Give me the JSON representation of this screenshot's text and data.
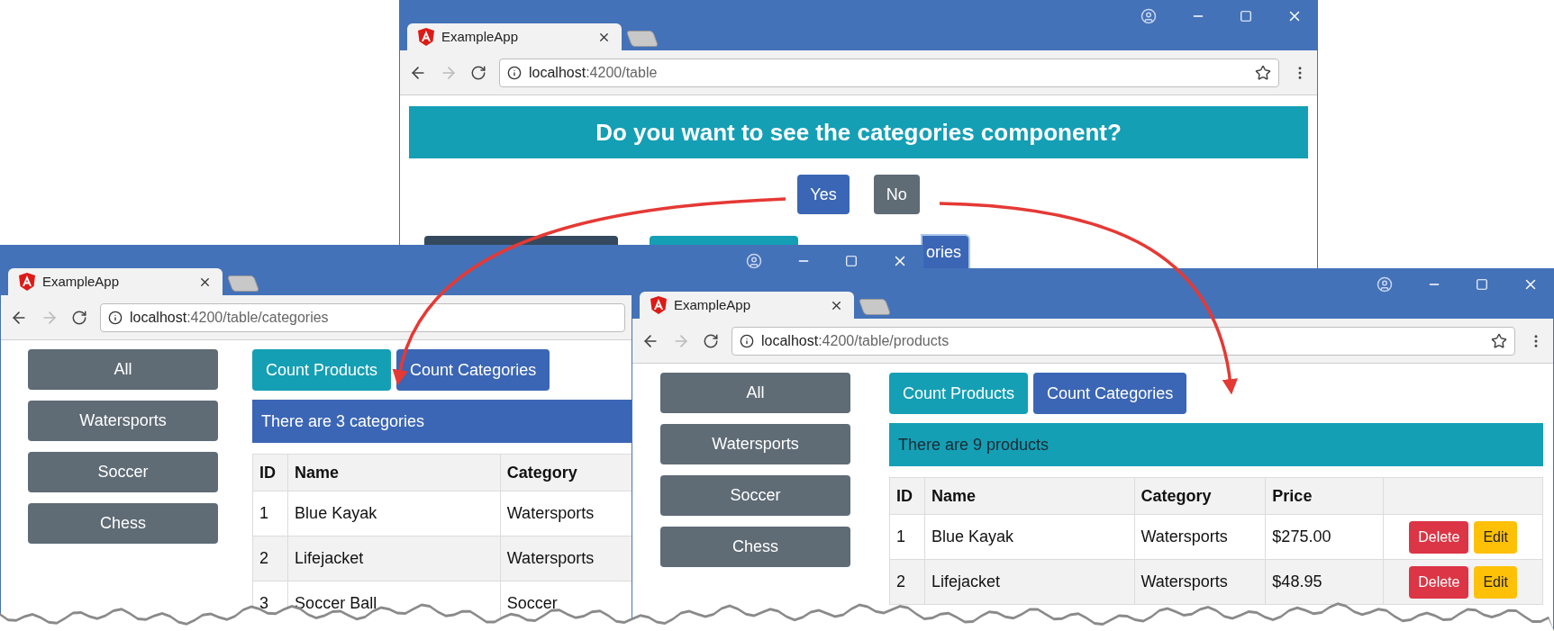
{
  "question_window": {
    "tab_title": "ExampleApp",
    "url": "**localhost**:4200/table",
    "banner": "Do you want to see the categories component?",
    "buttons": [
      {
        "label": "Yes",
        "kind": "primary"
      },
      {
        "label": "No",
        "kind": "secondary"
      }
    ],
    "partial_buttons": [
      {
        "kind": "dark"
      },
      {
        "kind": "teal"
      },
      {
        "kind": "outline",
        "label": "ories"
      }
    ]
  },
  "categories_window": {
    "tab_title": "ExampleApp",
    "url": "**localhost**:4200/table/categories",
    "filters": [
      "All",
      "Watersports",
      "Soccer",
      "Chess"
    ],
    "count_buttons": [
      {
        "label": "Count Products",
        "kind": "teal"
      },
      {
        "label": "Count Categories",
        "kind": "primary"
      }
    ],
    "message": {
      "text": "There are 3 categories",
      "kind": "primary"
    },
    "table": {
      "columns": [
        "ID",
        "Name",
        "Category"
      ],
      "rows": [
        {
          "cells": [
            "1",
            "Blue Kayak",
            "Watersports"
          ]
        },
        {
          "cells": [
            "2",
            "Lifejacket",
            "Watersports"
          ]
        },
        {
          "cells": [
            "3",
            "Soccer Ball",
            "Soccer"
          ]
        }
      ]
    }
  },
  "products_window": {
    "tab_title": "ExampleApp",
    "url": "**localhost**:4200/table/products",
    "filters": [
      "All",
      "Watersports",
      "Soccer",
      "Chess"
    ],
    "count_buttons": [
      {
        "label": "Count Products",
        "kind": "teal"
      },
      {
        "label": "Count Categories",
        "kind": "primary"
      }
    ],
    "message": {
      "text": "There are 9 products",
      "kind": "teal"
    },
    "table": {
      "columns": [
        "ID",
        "Name",
        "Category",
        "Price"
      ],
      "rows": [
        {
          "cells": [
            "1",
            "Blue Kayak",
            "Watersports",
            "$275.00"
          ],
          "actions": [
            "Delete",
            "Edit"
          ]
        },
        {
          "cells": [
            "2",
            "Lifejacket",
            "Watersports",
            "$48.95"
          ],
          "actions": [
            "Delete",
            "Edit"
          ]
        }
      ]
    }
  }
}
